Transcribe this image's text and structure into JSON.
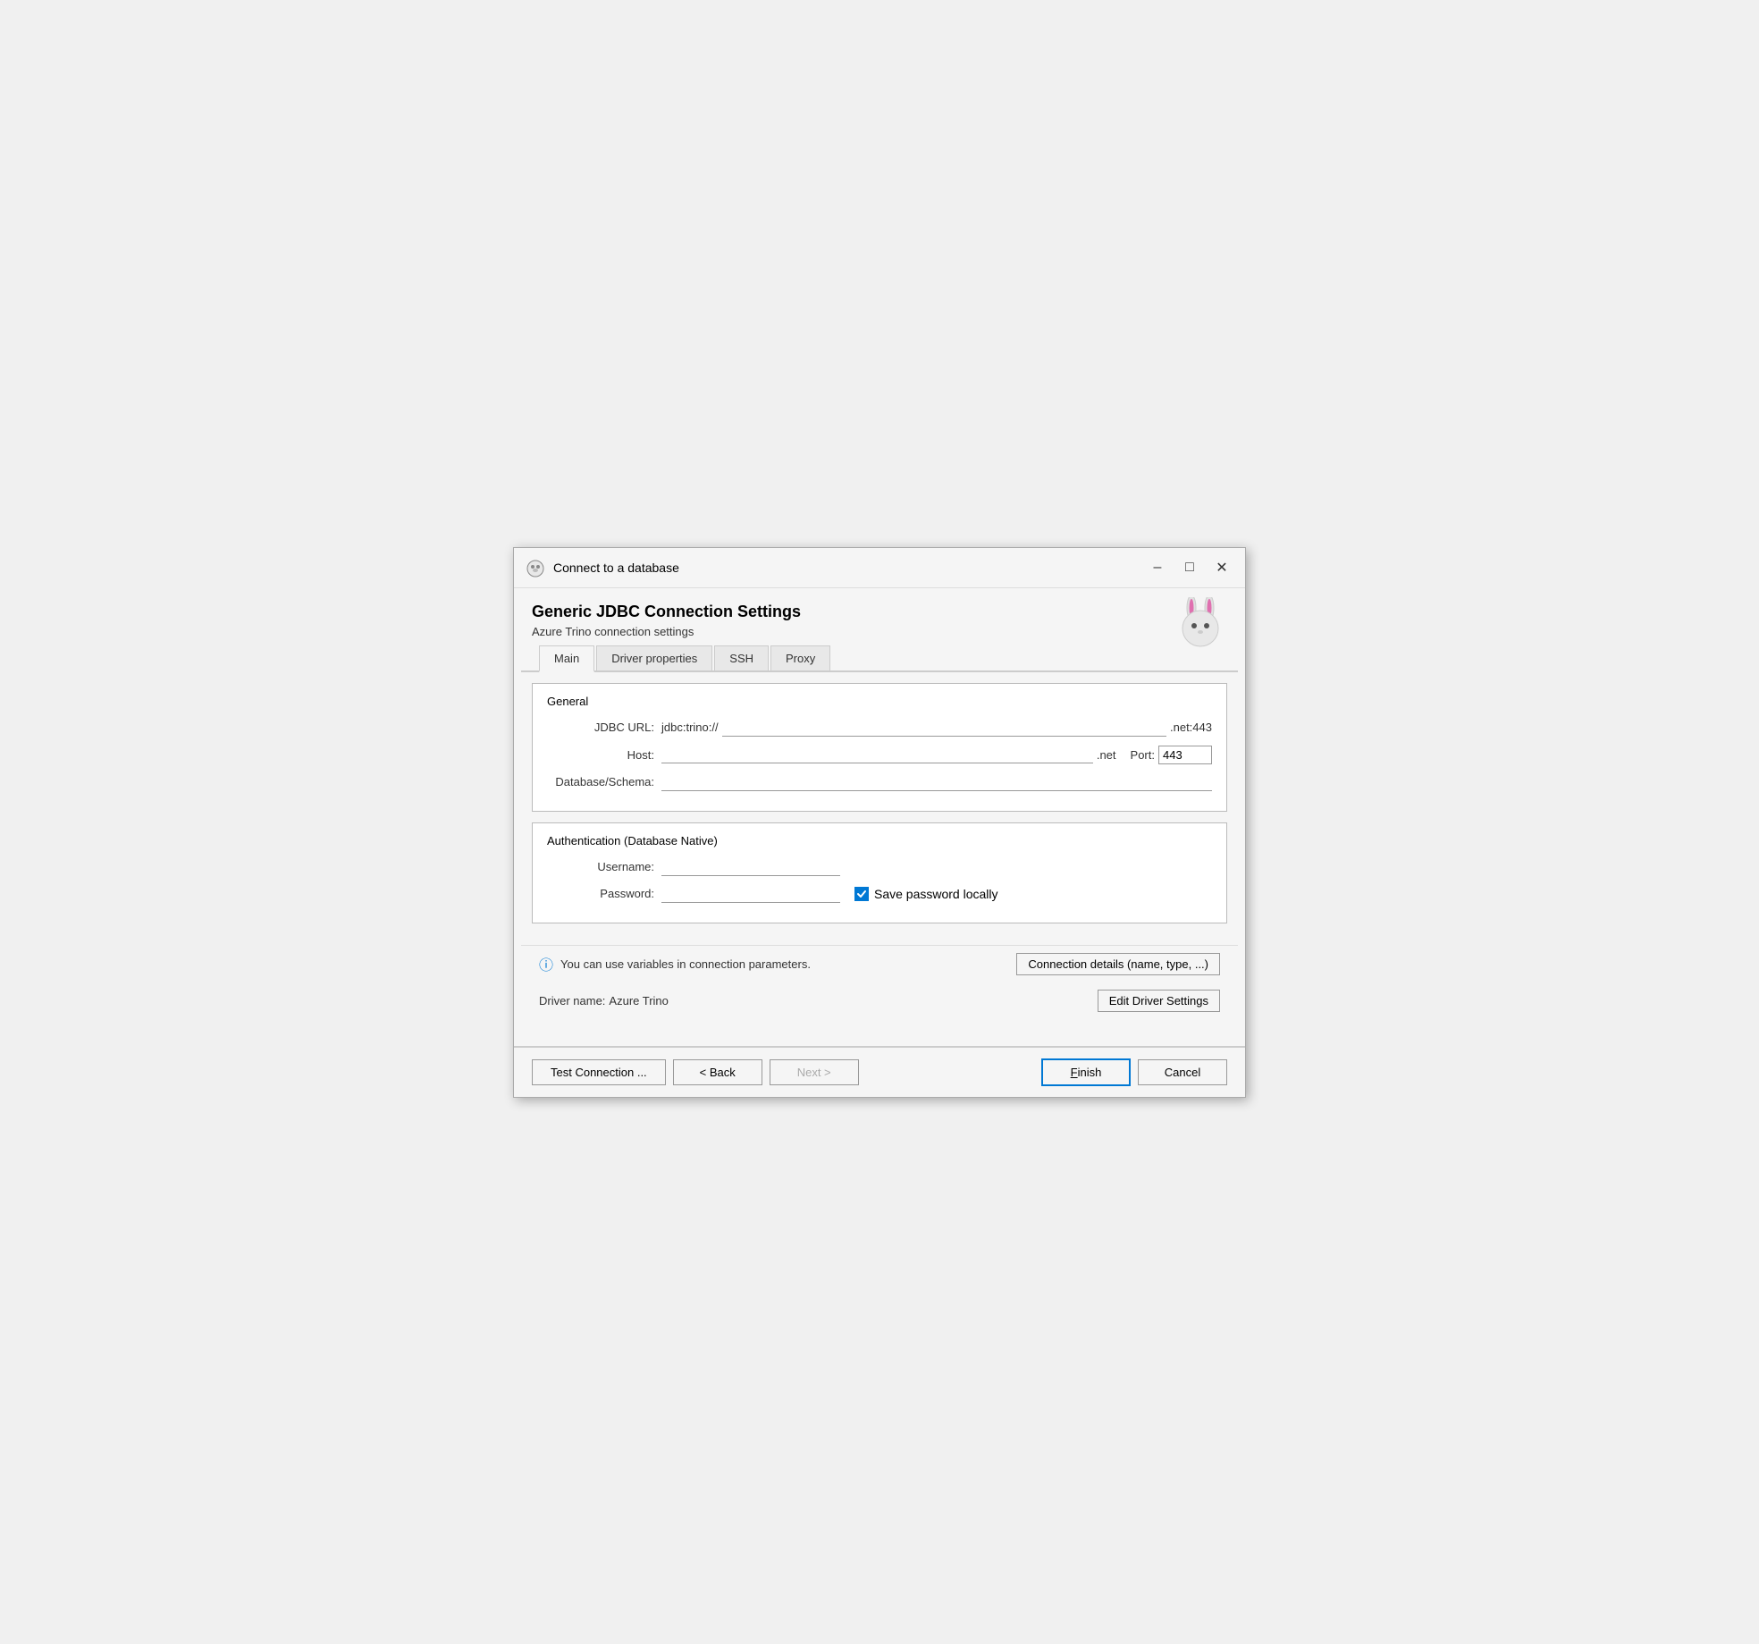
{
  "window": {
    "title": "Connect to a database",
    "minimize_label": "–",
    "maximize_label": "□",
    "close_label": "✕"
  },
  "header": {
    "main_title": "Generic JDBC Connection Settings",
    "subtitle": "Azure Trino connection settings"
  },
  "tabs": [
    {
      "id": "main",
      "label": "Main",
      "active": true
    },
    {
      "id": "driver-properties",
      "label": "Driver properties",
      "active": false
    },
    {
      "id": "ssh",
      "label": "SSH",
      "active": false
    },
    {
      "id": "proxy",
      "label": "Proxy",
      "active": false
    }
  ],
  "general": {
    "section_title": "General",
    "jdbc_url_label": "JDBC URL:",
    "jdbc_prefix": "jdbc:trino://",
    "jdbc_value": "",
    "jdbc_suffix": ".net:443",
    "host_label": "Host:",
    "host_value": "",
    "host_suffix": ".net",
    "port_label": "Port:",
    "port_value": "443",
    "db_label": "Database/Schema:",
    "db_value": ""
  },
  "authentication": {
    "section_title": "Authentication (Database Native)",
    "username_label": "Username:",
    "username_value": "",
    "password_label": "Password:",
    "password_value": "",
    "save_password_label": "Save password locally",
    "save_password_checked": true
  },
  "bottom": {
    "info_text": "You can use variables in connection parameters.",
    "connection_details_btn": "Connection details (name, type, ...)",
    "driver_label": "Driver name:",
    "driver_name": "Azure Trino",
    "edit_driver_btn": "Edit Driver Settings"
  },
  "footer": {
    "test_connection_btn": "Test Connection ...",
    "back_btn": "< Back",
    "next_btn": "Next >",
    "finish_btn": "Finish",
    "cancel_btn": "Cancel"
  }
}
